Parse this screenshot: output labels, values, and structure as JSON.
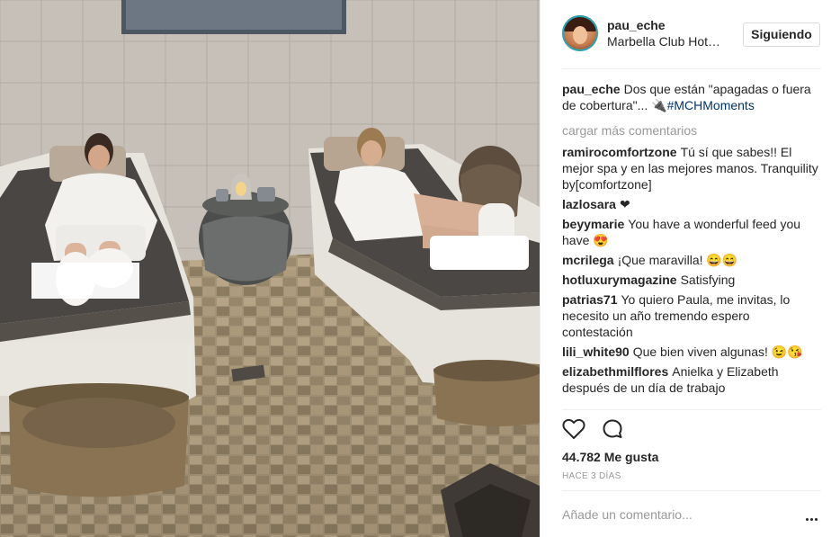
{
  "post": {
    "author": "pau_eche",
    "location": "Marbella Club Hot…",
    "follow_label": "Siguiendo",
    "caption": {
      "user": "pau_eche",
      "text": "Dos que están \"apagadas o fuera de cobertura\"... 🔌",
      "hashtag": "#MCHMoments"
    },
    "load_more": "cargar más comentarios",
    "likes": "44.782 Me gusta",
    "time": "HACE 3 DÍAS",
    "comment_placeholder": "Añade un comentario..."
  },
  "comments": [
    {
      "user": "ramirocomfortzone",
      "text": "Tú sí que sabes!! El mejor spa y en las mejores manos. Tranquility by[comfortzone]"
    },
    {
      "user": "lazlosara",
      "text": "❤"
    },
    {
      "user": "beyymarie",
      "text": "You have a wonderful feed you have 😍"
    },
    {
      "user": "mcrilega",
      "text": "¡Que maravilla! 😄😄"
    },
    {
      "user": "hotluxurymagazine",
      "text": "Satisfying"
    },
    {
      "user": "patrias71",
      "text": "Yo quiero Paula, me invitas, lo necesito un año tremendo espero contestación"
    },
    {
      "user": "lili_white90",
      "text": "Que bien viven algunas! 😉😘"
    },
    {
      "user": "elizabethmilflores",
      "text": "Anielka y Elizabeth después de un día de trabajo"
    }
  ],
  "icons": {
    "like": "heart-outline-icon",
    "comment": "speech-bubble-icon",
    "more": "ellipsis-icon"
  },
  "colors": {
    "text": "#262626",
    "muted": "#999999",
    "link": "#003569",
    "border": "#dbdbdb"
  }
}
